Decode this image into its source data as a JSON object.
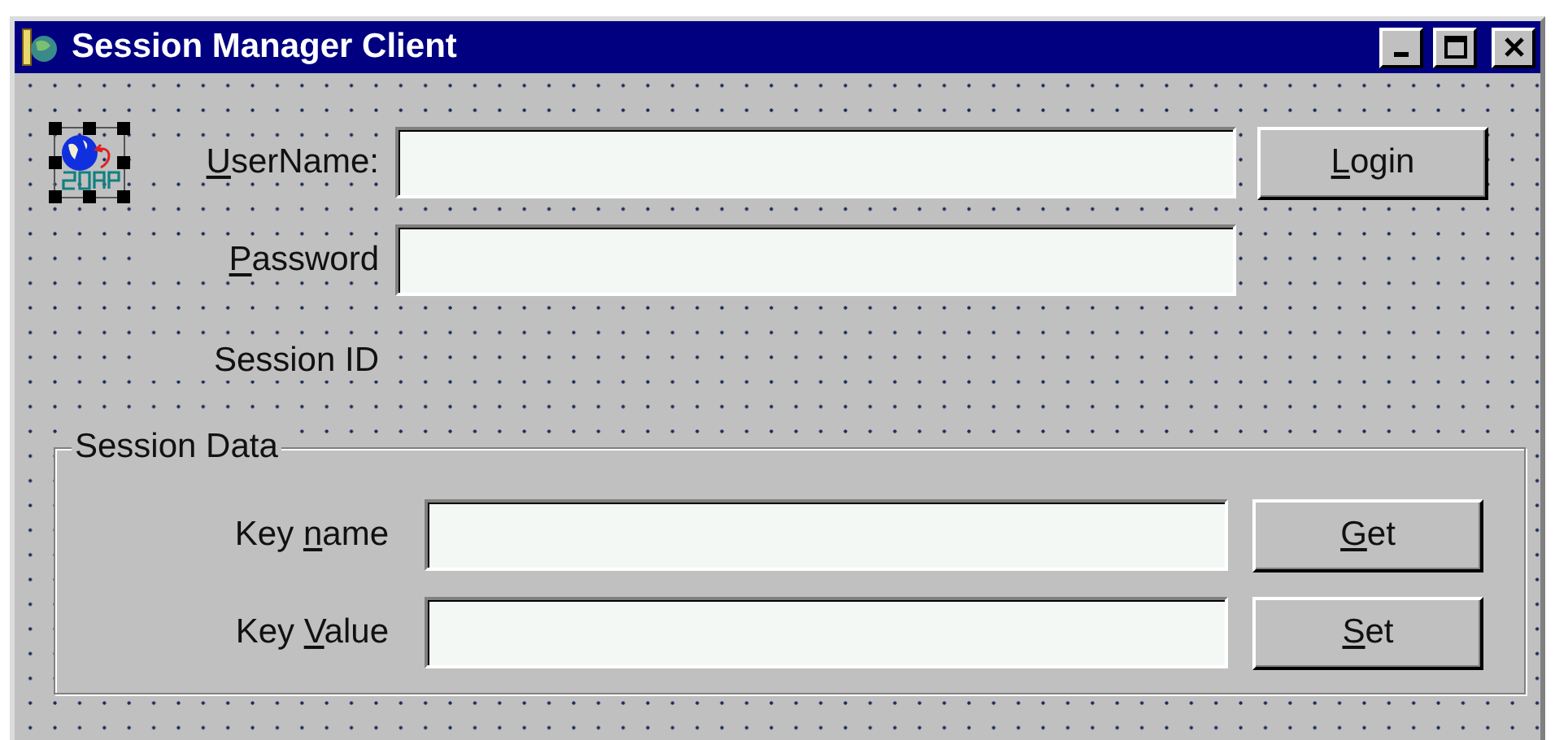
{
  "window": {
    "title": "Session Manager Client"
  },
  "soap_component": {
    "selected": true
  },
  "fields": [
    {
      "label": {
        "access_key": "U",
        "post": "serName:"
      }
    },
    {
      "label": {
        "access_key": "P",
        "post": "assword"
      }
    }
  ],
  "login_button": {
    "access_key": "L",
    "post": "ogin"
  },
  "session_id_label": "Session ID",
  "session_data": {
    "title": "Session Data",
    "rows": [
      {
        "label": {
          "pre": "Key ",
          "access_key": "n",
          "post": "ame"
        },
        "button": {
          "access_key": "G",
          "post": "et"
        }
      },
      {
        "label": {
          "pre": "Key ",
          "access_key": "V",
          "post": "alue"
        },
        "button": {
          "access_key": "S",
          "post": "et"
        }
      }
    ]
  }
}
